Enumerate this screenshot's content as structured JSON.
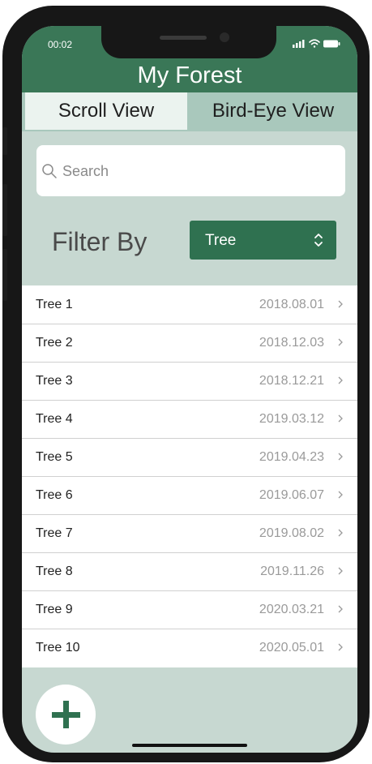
{
  "status_bar": {
    "time": "00:02"
  },
  "header": {
    "title": "My Forest"
  },
  "tabs": [
    {
      "label": "Scroll View",
      "active": true
    },
    {
      "label": "Bird-Eye View",
      "active": false
    }
  ],
  "search": {
    "placeholder": "Search"
  },
  "filter": {
    "label": "Filter By",
    "selected": "Tree"
  },
  "trees": [
    {
      "name": "Tree 1",
      "date": "2018.08.01"
    },
    {
      "name": "Tree 2",
      "date": "2018.12.03"
    },
    {
      "name": "Tree 3",
      "date": "2018.12.21"
    },
    {
      "name": "Tree 4",
      "date": "2019.03.12"
    },
    {
      "name": "Tree 5",
      "date": "2019.04.23"
    },
    {
      "name": "Tree 6",
      "date": "2019.06.07"
    },
    {
      "name": "Tree 7",
      "date": "2019.08.02"
    },
    {
      "name": "Tree 8",
      "date": "2019.11.26"
    },
    {
      "name": "Tree 9",
      "date": "2020.03.21"
    },
    {
      "name": "Tree 10",
      "date": "2020.05.01"
    }
  ],
  "icons": {
    "search": "search-icon",
    "chevron_row": "chevron-right-icon",
    "dropdown": "chevron-updown-icon",
    "add": "plus-icon"
  },
  "colors": {
    "header": "#3a7757",
    "accent": "#2f7150",
    "background": "#c7d8d1",
    "tab_bar": "#a9c8bc"
  }
}
